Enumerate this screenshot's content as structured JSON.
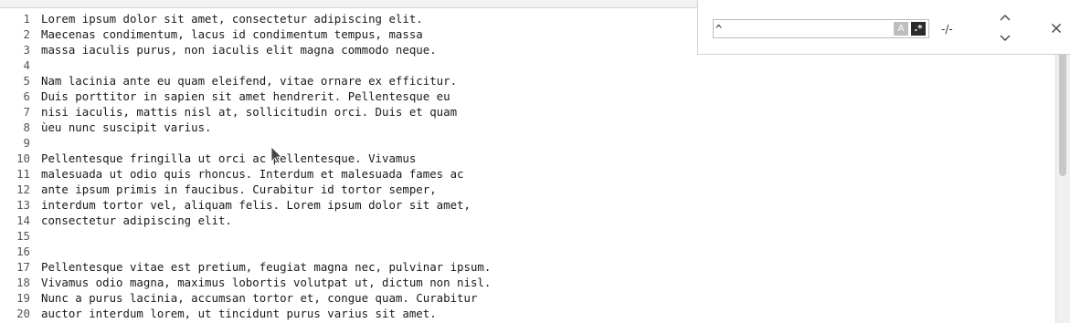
{
  "editor": {
    "lines": [
      {
        "n": "1",
        "text": "Lorem ipsum dolor sit amet, consectetur adipiscing elit."
      },
      {
        "n": "2",
        "text": "Maecenas condimentum, lacus id condimentum tempus, massa"
      },
      {
        "n": "3",
        "text": "massa iaculis purus, non iaculis elit magna commodo neque."
      },
      {
        "n": "4",
        "text": ""
      },
      {
        "n": "5",
        "text": "Nam lacinia ante eu quam eleifend, vitae ornare ex efficitur."
      },
      {
        "n": "6",
        "text": "Duis porttitor in sapien sit amet hendrerit. Pellentesque eu"
      },
      {
        "n": "7",
        "text": "nisi iaculis, mattis nisl at, sollicitudin orci. Duis et quam"
      },
      {
        "n": "8",
        "text": "ùeu nunc suscipit varius."
      },
      {
        "n": "9",
        "text": ""
      },
      {
        "n": "10",
        "text": "Pellentesque fringilla ut orci ac pellentesque. Vivamus"
      },
      {
        "n": "11",
        "text": "malesuada ut odio quis rhoncus. Interdum et malesuada fames ac"
      },
      {
        "n": "12",
        "text": "ante ipsum primis in faucibus. Curabitur id tortor semper,"
      },
      {
        "n": "13",
        "text": "interdum tortor vel, aliquam felis. Lorem ipsum dolor sit amet,"
      },
      {
        "n": "14",
        "text": "consectetur adipiscing elit."
      },
      {
        "n": "15",
        "text": ""
      },
      {
        "n": "16",
        "text": ""
      },
      {
        "n": "17",
        "text": "Pellentesque vitae est pretium, feugiat magna nec, pulvinar ipsum."
      },
      {
        "n": "18",
        "text": "Vivamus odio magna, maximus lobortis volutpat ut, dictum non nisl."
      },
      {
        "n": "19",
        "text": "Nunc a purus lacinia, accumsan tortor et, congue quam. Curabitur"
      },
      {
        "n": "20",
        "text": "auctor interdum lorem, ut tincidunt purus varius sit amet."
      }
    ]
  },
  "find": {
    "query": "^",
    "case_toggle_label": "A",
    "regex_toggle_label": ".*",
    "match_count": "-/-",
    "icons": {
      "case": "match-case-icon",
      "regex": "regex-icon",
      "up": "chevron-up-icon",
      "down": "chevron-down-icon",
      "close": "close-icon"
    }
  }
}
